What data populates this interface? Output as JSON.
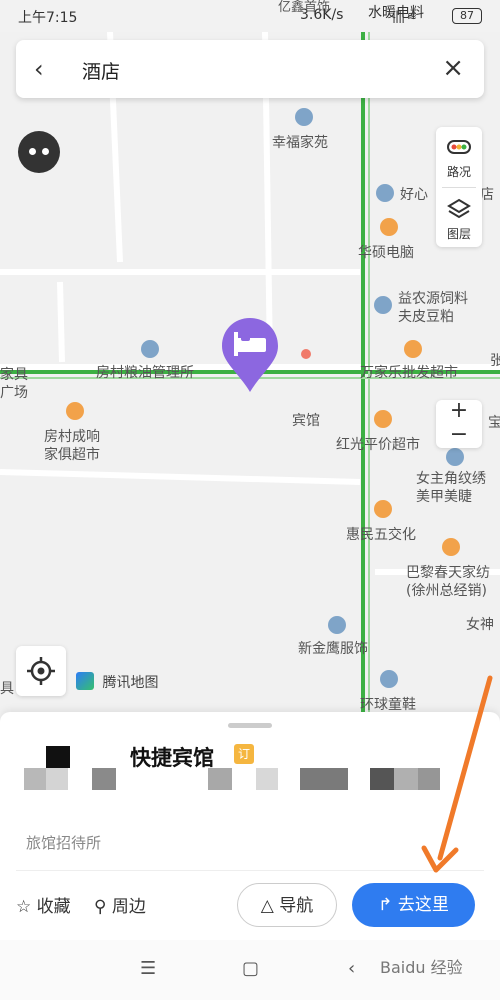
{
  "status": {
    "time": "上午7:15",
    "net": "3.6K/s",
    "battery": "87",
    "signal": "|||| ≋"
  },
  "search": {
    "query": "酒店"
  },
  "controls": {
    "traffic": "路况",
    "layers": "图层",
    "zoom_in": "+",
    "zoom_out": "−"
  },
  "map_labels": {
    "xingfu": "幸福家苑",
    "haoxin": "好心",
    "dian": "店",
    "huashuo": "华硕电脑",
    "yinong": "益农源饲料\n夫皮豆粕",
    "fangcun_grain": "房村粮油管理所",
    "wanjiale": "万家乐批发超市",
    "fangcun_furniture": "房村成响\n家俱超市",
    "binguan": "宾馆",
    "hongguang": "红光平价超市",
    "nvzhujiao": "女主角纹绣\n美甲美睫",
    "huimin": "惠民五交化",
    "bali": "巴黎春天家纺\n(徐州总经销)",
    "xinjinying": "新金鹰服饰",
    "nvshen": "女神",
    "huanqiu": "环球童鞋",
    "left_edge_top": "家具\n广场",
    "right_edge": "张",
    "bao": "宝",
    "yixin": "亿鑫首饰",
    "shuinuan": "水暖电料",
    "ju": "具"
  },
  "brand": {
    "label": "腾讯地图"
  },
  "place": {
    "name": "快捷宾馆",
    "badge": "订",
    "type": "旅馆招待所"
  },
  "actions": {
    "favorite": "收藏",
    "nearby": "周边",
    "navigate": "导航",
    "go_here": "去这里"
  },
  "watermark": "Baidu 经验",
  "colors": {
    "accent": "#2f7cf0",
    "marker": "#8c67e0",
    "road": "#3cb043",
    "annotation": "#f07a2a"
  }
}
